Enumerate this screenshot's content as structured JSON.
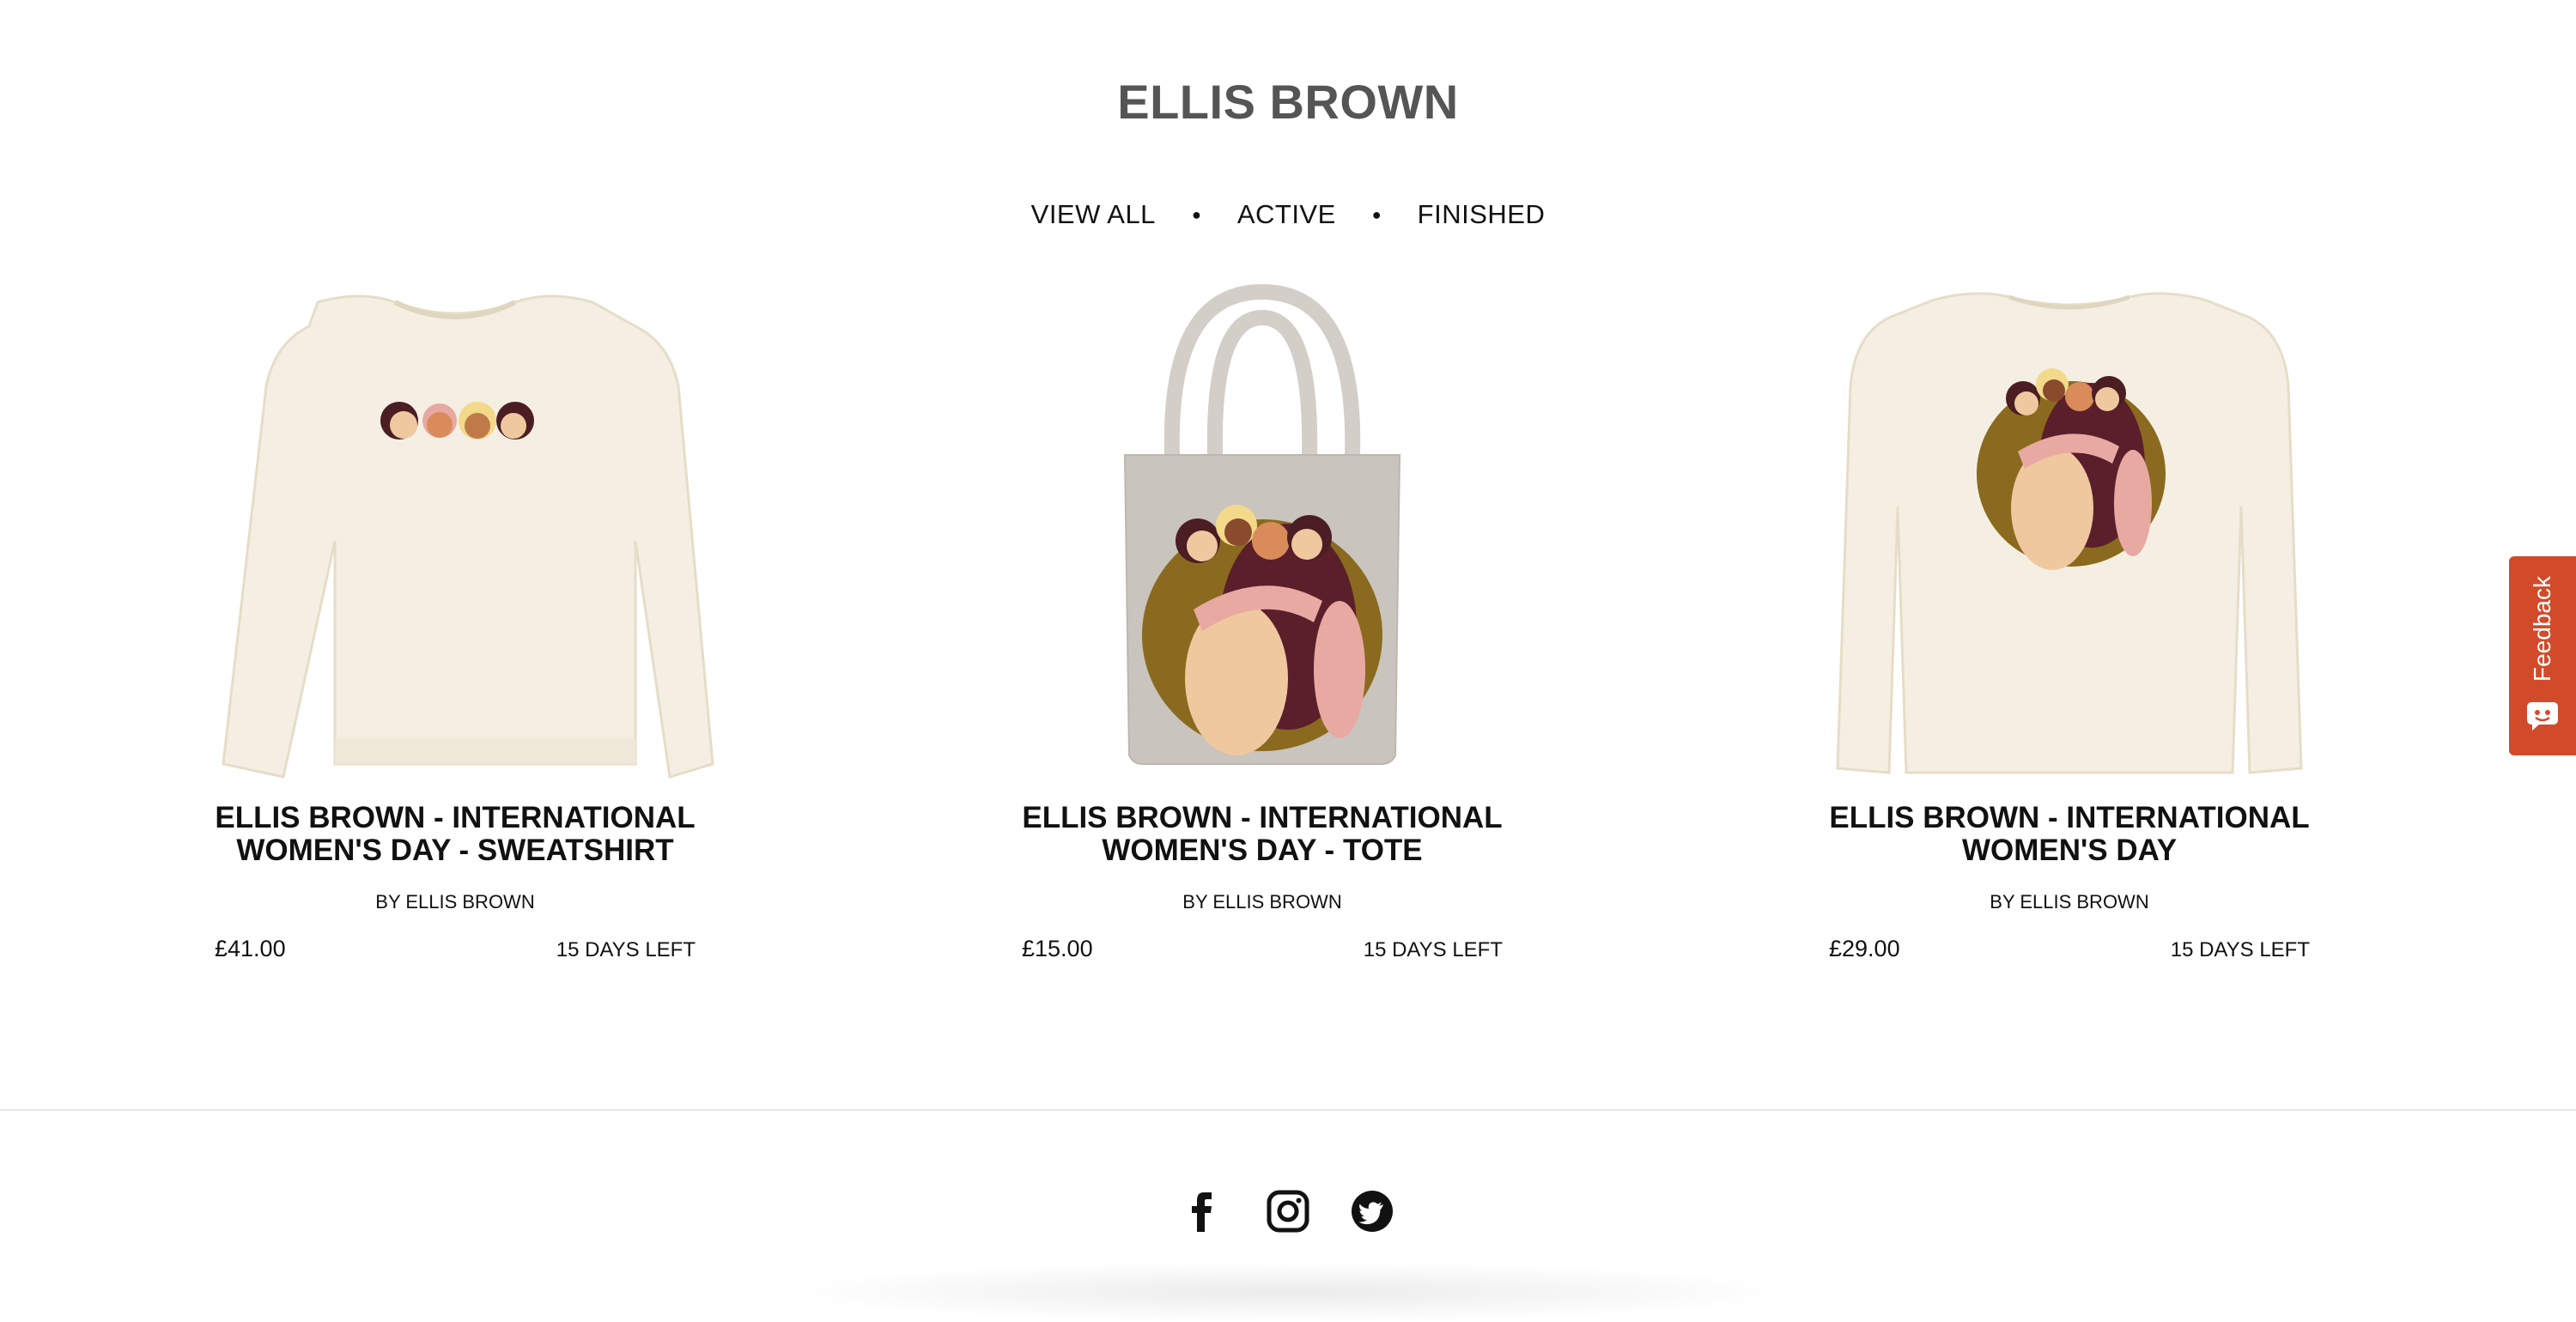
{
  "page": {
    "title": "ELLIS BROWN"
  },
  "filters": [
    {
      "label": "VIEW ALL"
    },
    {
      "label": "ACTIVE"
    },
    {
      "label": "FINISHED"
    }
  ],
  "products": [
    {
      "title": "ELLIS BROWN - INTERNATIONAL WOMEN'S DAY - SWEATSHIRT",
      "byline": "BY ELLIS BROWN",
      "price": "£41.00",
      "days_left": "15 DAYS LEFT",
      "image": "sweatshirt"
    },
    {
      "title": "ELLIS BROWN - INTERNATIONAL WOMEN'S DAY - TOTE",
      "byline": "BY ELLIS BROWN",
      "price": "£15.00",
      "days_left": "15 DAYS LEFT",
      "image": "tote-bag"
    },
    {
      "title": "ELLIS BROWN - INTERNATIONAL WOMEN'S DAY",
      "byline": "BY ELLIS BROWN",
      "price": "£29.00",
      "days_left": "15 DAYS LEFT",
      "image": "long-sleeve-tee"
    }
  ],
  "social": [
    {
      "icon": "facebook-icon"
    },
    {
      "icon": "instagram-icon"
    },
    {
      "icon": "twitter-icon"
    }
  ],
  "feedback": {
    "label": "Feedback",
    "icon": "feedback-chat-icon"
  },
  "colors": {
    "title": "#555555",
    "text": "#111111",
    "feedback_bg": "#d14b2b",
    "garment_cream": "#f4efe2",
    "tote_grey": "#c9c4bd",
    "skin_light": "#f0c8a0",
    "skin_mid": "#d98c5a",
    "skin_dark": "#8a4a2e",
    "hair_dark": "#4a1e22",
    "olive": "#8a6a1e",
    "maroon": "#5a1f2a",
    "pink": "#e8a9a3"
  }
}
